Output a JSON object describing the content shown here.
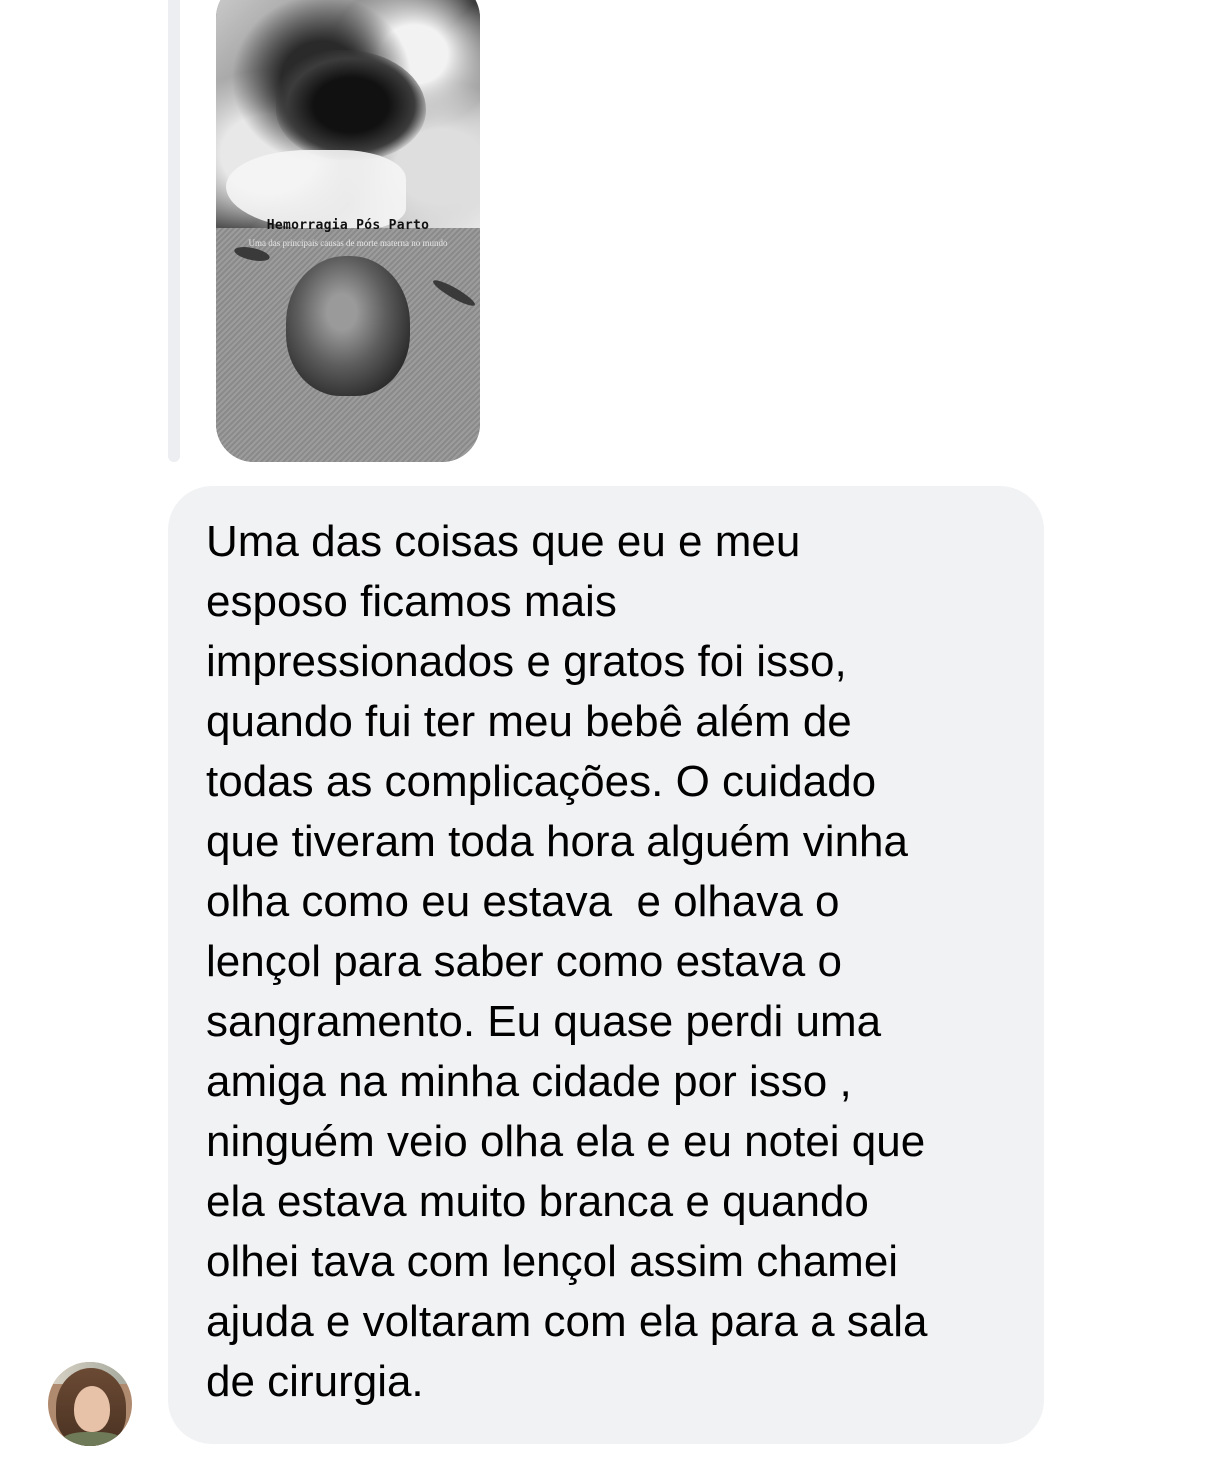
{
  "reply": {
    "story": {
      "title": "Hemorragia Pós Parto",
      "subtitle": "Uma das principais causas de morte materna no mundo"
    }
  },
  "message": {
    "lines": [
      "Uma das coisas que eu e meu",
      "esposo ficamos mais",
      "impressionados e gratos foi isso,",
      "quando fui ter meu bebê além de",
      "todas as complicações. O cuidado",
      "que tiveram toda hora alguém vinha",
      "olha como eu estava  e olhava o",
      "lençol para saber como estava o",
      "sangramento. Eu quase perdi uma",
      "amiga na minha cidade por isso ,",
      "ninguém veio olha ela e eu notei que",
      "ela estava muito branca e quando",
      "olhei tava com lençol assim chamei",
      "ajuda e voltaram com ela para a sala",
      "de cirurgia."
    ]
  },
  "colors": {
    "bubble_background": "#f1f2f4",
    "reply_bar": "#eceef1",
    "text": "#000000"
  }
}
